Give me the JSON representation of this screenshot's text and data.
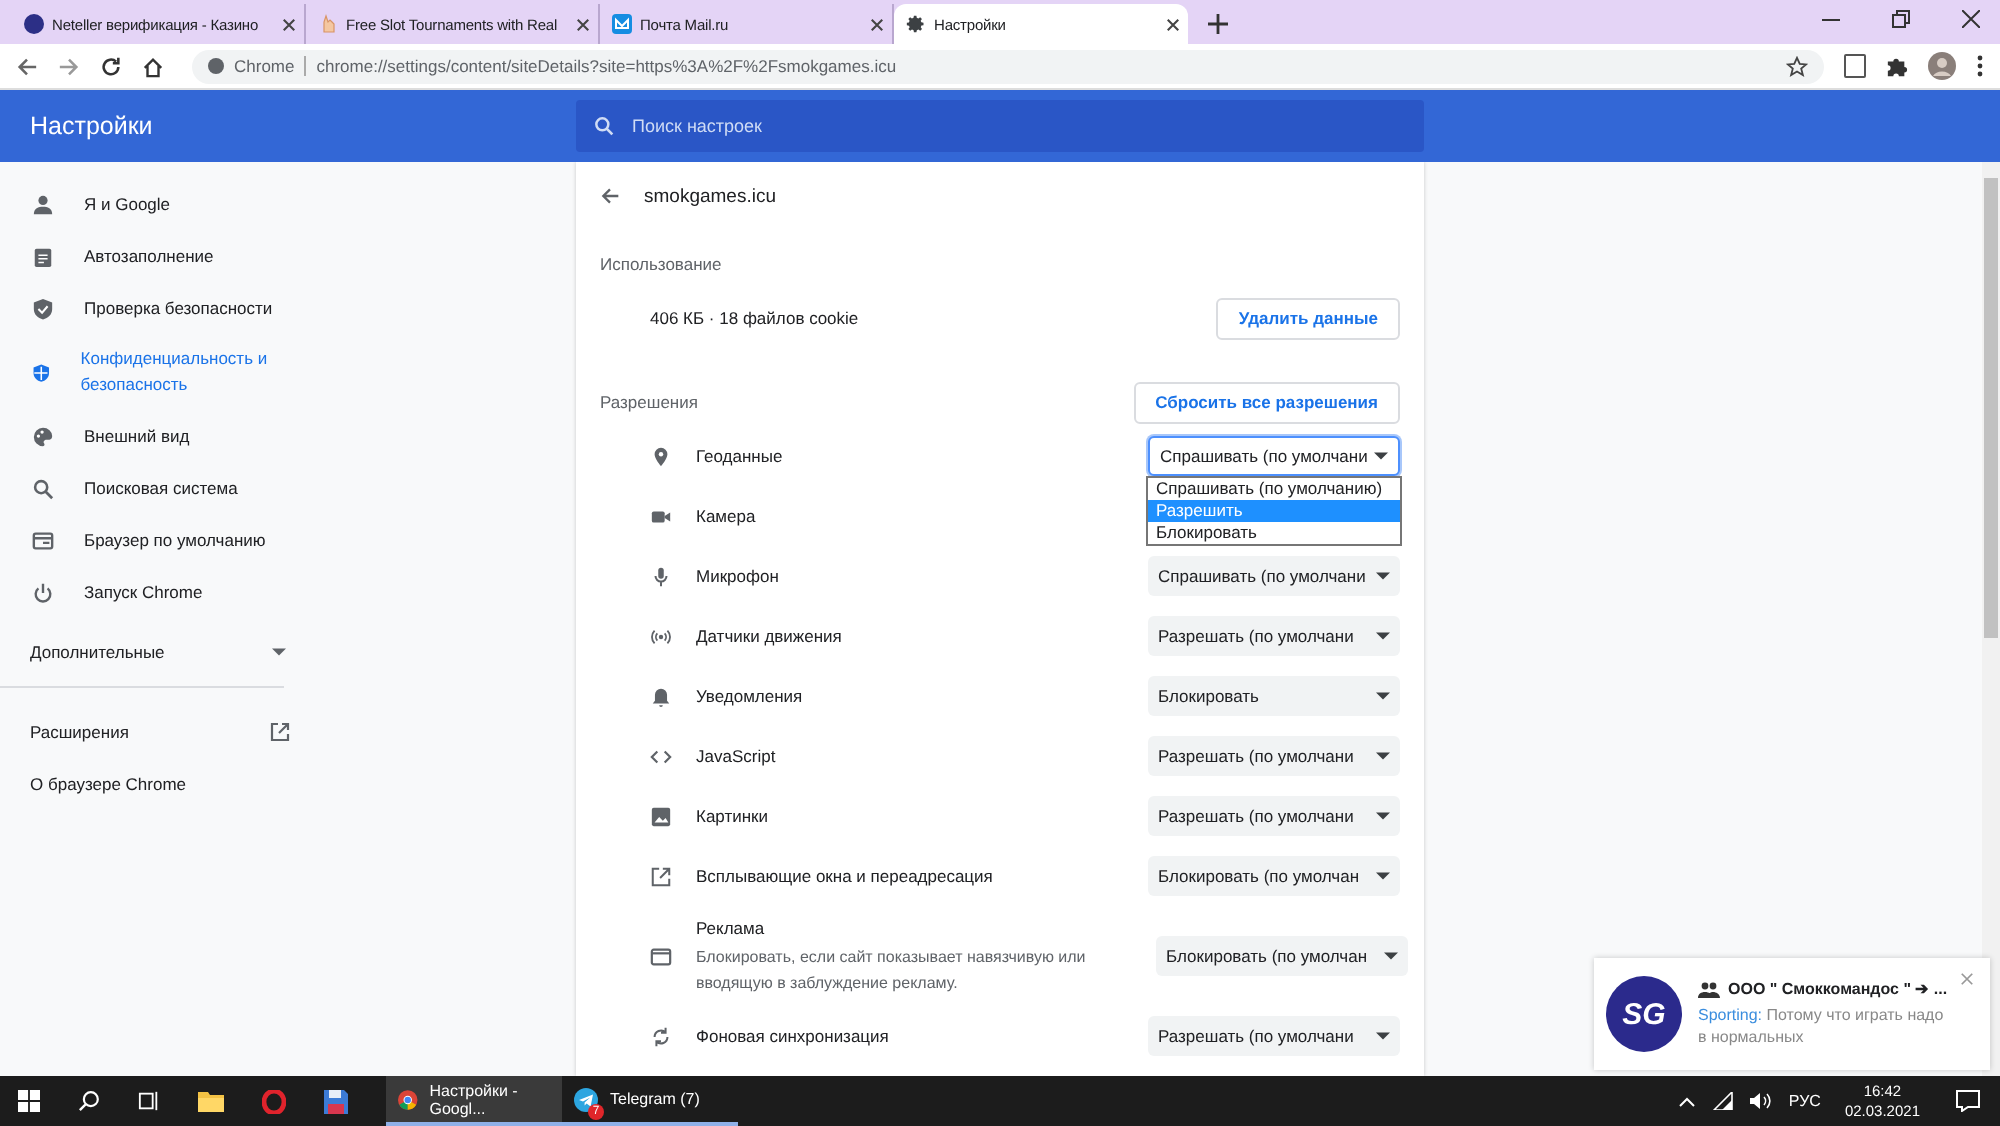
{
  "tabs": [
    {
      "title": "Neteller верификация - Казино",
      "selected": false
    },
    {
      "title": "Free Slot Tournaments with Real",
      "selected": false
    },
    {
      "title": "Почта Mail.ru",
      "selected": false
    },
    {
      "title": "Настройки",
      "selected": true
    }
  ],
  "address_bar": {
    "chip": "Chrome",
    "url": "chrome://settings/content/siteDetails?site=https%3A%2F%2Fsmokgames.icu"
  },
  "header": {
    "title": "Настройки",
    "search_placeholder": "Поиск настроек"
  },
  "sidebar": {
    "items": [
      {
        "label": "Я и Google",
        "selected": false
      },
      {
        "label": "Автозаполнение",
        "selected": false
      },
      {
        "label": "Проверка безопасности",
        "selected": false
      },
      {
        "label": "Конфиденциальность и безопасность",
        "selected": true
      },
      {
        "label": "Внешний вид",
        "selected": false
      },
      {
        "label": "Поисковая система",
        "selected": false
      },
      {
        "label": "Браузер по умолчанию",
        "selected": false
      },
      {
        "label": "Запуск Chrome",
        "selected": false
      }
    ],
    "advanced": {
      "label": "Дополнительные",
      "expanded": false
    },
    "links": [
      {
        "label": "Расширения",
        "external": true
      },
      {
        "label": "О браузере Chrome",
        "external": false
      }
    ]
  },
  "site": {
    "name": "smokgames.icu",
    "usage_heading": "Использование",
    "usage": "406 КБ · 18 файлов cookie",
    "clear_button": "Удалить данные",
    "permissions_heading": "Разрешения",
    "reset_button": "Сбросить все разрешения",
    "permissions": [
      {
        "label": "Геоданные",
        "value": "Спрашивать (по умолчани",
        "options": [
          {
            "label": "Спрашивать (по умолчанию)",
            "selected": false
          },
          {
            "label": "Разрешить",
            "selected": true
          },
          {
            "label": "Блокировать",
            "selected": false
          }
        ]
      },
      {
        "label": "Камера"
      },
      {
        "label": "Микрофон",
        "value": "Спрашивать (по умолчани"
      },
      {
        "label": "Датчики движения",
        "value": "Разрешать (по умолчани"
      },
      {
        "label": "Уведомления",
        "value": "Блокировать"
      },
      {
        "label": "JavaScript",
        "value": "Разрешать (по умолчани"
      },
      {
        "label": "Картинки",
        "value": "Разрешать (по умолчани"
      },
      {
        "label": "Всплывающие окна и переадресация",
        "value": "Блокировать (по умолчан"
      },
      {
        "label": "Реклама",
        "description": "Блокировать, если сайт показывает навязчивую или вводящую в заблуждение рекламу.",
        "value": "Блокировать (по умолчан"
      },
      {
        "label": "Фоновая синхронизация",
        "value": "Разрешать (по умолчани"
      }
    ]
  },
  "notification": {
    "avatar": "SG",
    "title": "ООО \" Смоккомандос \" ➔ ...",
    "sender": "Sporting:",
    "message": "Потому что играть надо в нормальных"
  },
  "taskbar": {
    "apps": [
      {
        "label": "Настройки - Googl...",
        "active": true
      },
      {
        "label": "Telegram (7)",
        "badge": "7",
        "active": false
      }
    ],
    "language": "РУС",
    "time": "16:42",
    "date": "02.03.2021"
  }
}
